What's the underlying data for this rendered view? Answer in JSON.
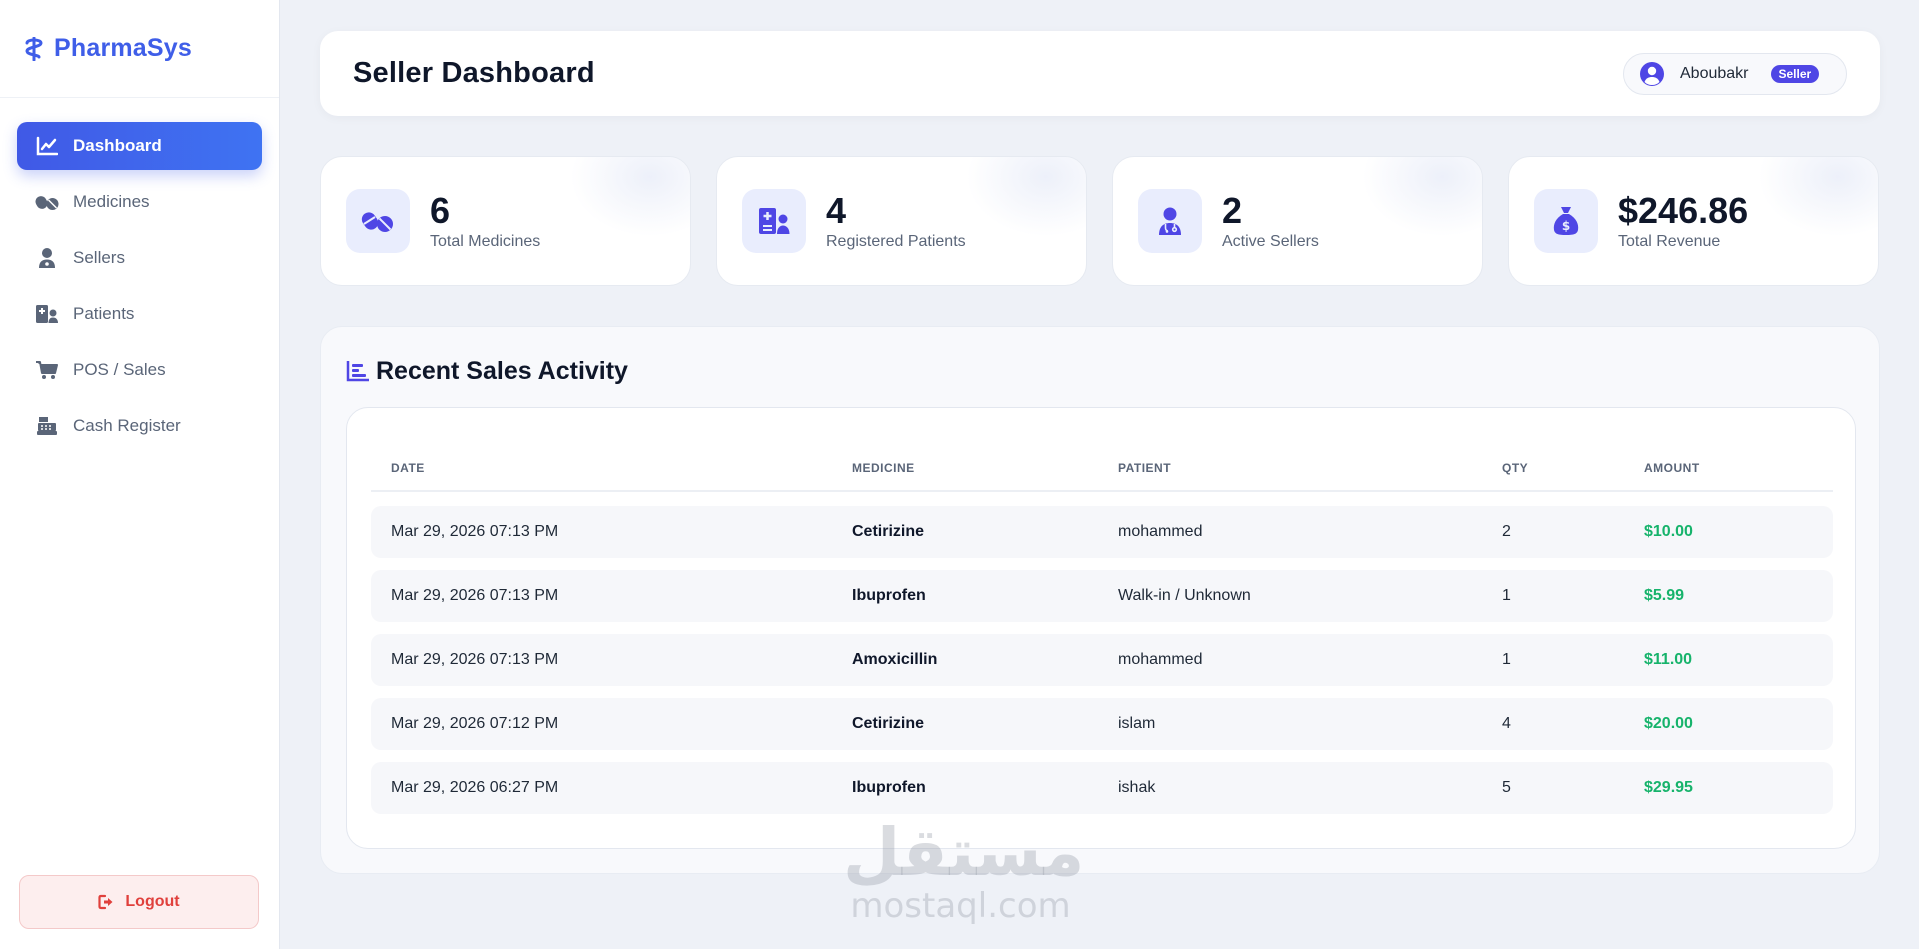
{
  "brand": {
    "name": "PharmaSys",
    "icon": "caduceus-icon"
  },
  "sidebar": {
    "items": [
      {
        "label": "Dashboard",
        "icon": "chart-line-icon",
        "active": true
      },
      {
        "label": "Medicines",
        "icon": "pills-icon",
        "active": false
      },
      {
        "label": "Sellers",
        "icon": "user-doctor-icon",
        "active": false
      },
      {
        "label": "Patients",
        "icon": "hospital-user-icon",
        "active": false
      },
      {
        "label": "POS / Sales",
        "icon": "cart-icon",
        "active": false
      },
      {
        "label": "Cash Register",
        "icon": "cash-register-icon",
        "active": false
      }
    ],
    "logout_label": "Logout"
  },
  "header": {
    "title": "Seller Dashboard",
    "user": {
      "name": "Aboubakr",
      "role": "Seller"
    }
  },
  "stats": [
    {
      "value": "6",
      "label": "Total Medicines",
      "icon": "pills-icon"
    },
    {
      "value": "4",
      "label": "Registered Patients",
      "icon": "hospital-user-icon"
    },
    {
      "value": "2",
      "label": "Active Sellers",
      "icon": "user-doctor-icon"
    },
    {
      "value": "$246.86",
      "label": "Total Revenue",
      "icon": "money-bag-icon"
    }
  ],
  "activity": {
    "title": "Recent Sales Activity",
    "columns": [
      "DATE",
      "MEDICINE",
      "PATIENT",
      "QTY",
      "AMOUNT"
    ],
    "rows": [
      {
        "date": "Mar 29, 2026 07:13 PM",
        "medicine": "Cetirizine",
        "patient": "mohammed",
        "qty": "2",
        "amount": "$10.00"
      },
      {
        "date": "Mar 29, 2026 07:13 PM",
        "medicine": "Ibuprofen",
        "patient": "Walk-in / Unknown",
        "qty": "1",
        "amount": "$5.99"
      },
      {
        "date": "Mar 29, 2026 07:13 PM",
        "medicine": "Amoxicillin",
        "patient": "mohammed",
        "qty": "1",
        "amount": "$11.00"
      },
      {
        "date": "Mar 29, 2026 07:12 PM",
        "medicine": "Cetirizine",
        "patient": "islam",
        "qty": "4",
        "amount": "$20.00"
      },
      {
        "date": "Mar 29, 2026 06:27 PM",
        "medicine": "Ibuprofen",
        "patient": "ishak",
        "qty": "5",
        "amount": "$29.95"
      }
    ]
  },
  "watermark": {
    "arabic": "مستقل",
    "latin": "mostaql.com"
  },
  "colors": {
    "accent": "#3f5ee8",
    "amount_green": "#16b36b",
    "logout_red": "#e0403c",
    "badge": "#4f46e5"
  }
}
